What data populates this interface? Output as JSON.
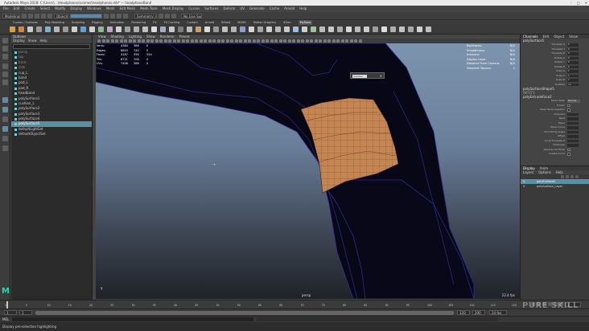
{
  "window": {
    "title": "Autodesk Maya 2018: C:\\Users\\...\\Headphones\\scenes\\headphones.mb* — headphoneBand",
    "controls": [
      "minimize-icon",
      "maximize-icon",
      "close-icon"
    ]
  },
  "menubar": {
    "items": [
      "File",
      "Edit",
      "Create",
      "Select",
      "Modify",
      "Display",
      "Windows",
      "Mesh",
      "Edit Mesh",
      "Mesh Tools",
      "Mesh Display",
      "Curves",
      "Surfaces",
      "Deform",
      "UV",
      "Generate",
      "Cache",
      "Arnold",
      "Help"
    ]
  },
  "statusline": {
    "mode_menu": "Modeling",
    "object_selector": "Objects",
    "symmetry": "Symmetry: Off",
    "no_live": "No Live Surface"
  },
  "shelf": {
    "tabs": [
      "Curves / Surfaces",
      "Poly Modeling",
      "Sculpting",
      "Rigging",
      "Animation",
      "Rendering",
      "FX",
      "FX Caching",
      "Custom",
      "Arnold",
      "Bifrost",
      "MASH",
      "Motion Graphics",
      "XGen",
      "MyTools"
    ],
    "active_tab": "MyTools",
    "icon_colors": [
      "#d5a24a",
      "#e0803a",
      "#c9c9c9",
      "#9a9a9a",
      "#7fb0d0",
      "#b7b7b7",
      "#9a9a9a",
      "#cfcfcf",
      "#6b9fd1",
      "#d1d1d1",
      "#8fb98f",
      "#c8a0d0",
      "#d0d0d0",
      "#a0a0a0",
      "#b0b0b0",
      "#c0c0c0",
      "#dddddd",
      "#9fb0c8",
      "#c8c8c8",
      "#7c7c7c",
      "#bbbbbb",
      "#d0a060",
      "#dddddd",
      "#9a9a9a",
      "#c0c0c0",
      "#b5b5b5",
      "#8aa0c8",
      "#d5d5d5",
      "#a5a5a5",
      "#cfcfcf",
      "#b8b8b8",
      "#c8c8c8",
      "#9fbfdf",
      "#d0d0d0",
      "#a0c0a0",
      "#bbbbbb",
      "#c9c9c9",
      "#aaaaaa",
      "#d9d9d9",
      "#bcbcbc",
      "#cccccc",
      "#9d9d9d",
      "#dddddd",
      "#b0b0b0",
      "#c4c4c4",
      "#a8a8a8",
      "#d2d2d2",
      "#bfbfbf"
    ]
  },
  "outliner": {
    "title": "Outliner",
    "menus": [
      "Display",
      "Show",
      "Help"
    ],
    "items": [
      {
        "label": "persp",
        "state": "dim"
      },
      {
        "label": "top",
        "state": "dim"
      },
      {
        "label": "front",
        "state": "dim"
      },
      {
        "label": "side",
        "state": "dim"
      },
      {
        "label": "cup_L",
        "state": "normal"
      },
      {
        "label": "band",
        "state": "normal"
      },
      {
        "label": "pad_L",
        "state": "normal"
      },
      {
        "label": "pad_R",
        "state": "normal"
      },
      {
        "label": "headband",
        "state": "normal"
      },
      {
        "label": "polySurface1",
        "state": "normal"
      },
      {
        "label": "cushion_L",
        "state": "normal"
      },
      {
        "label": "polySurface2",
        "state": "normal"
      },
      {
        "label": "polySurface3",
        "state": "normal"
      },
      {
        "label": "polySurface4",
        "state": "normal"
      },
      {
        "label": "polySurface5",
        "state": "selected"
      },
      {
        "label": "defaultLightSet",
        "state": "normal"
      },
      {
        "label": "defaultObjectSet",
        "state": "normal"
      }
    ]
  },
  "viewport": {
    "menus": [
      "View",
      "Shading",
      "Lighting",
      "Show",
      "Renderer",
      "Panels"
    ],
    "hud_left": {
      "header": [
        "",
        "",
        "",
        ""
      ],
      "rows": [
        {
          "label": "Verts:",
          "values": [
            "4384",
            "386",
            "0"
          ]
        },
        {
          "label": "Edges:",
          "values": [
            "8843",
            "740",
            "0"
          ]
        },
        {
          "label": "Faces:",
          "values": [
            "4187",
            "356",
            "354"
          ]
        },
        {
          "label": "Tris:",
          "values": [
            "8721",
            "708",
            "0"
          ]
        },
        {
          "label": "UVs:",
          "values": [
            "7408",
            "386",
            "0"
          ]
        }
      ]
    },
    "hud_right": [
      {
        "label": "Backfaces:",
        "value": "N/A"
      },
      {
        "label": "Smoothness:",
        "value": "N/A"
      },
      {
        "label": "Instance:",
        "value": "N/A"
      },
      {
        "label": "Display Layer:",
        "value": "N/A"
      },
      {
        "label": "Distance From Camera:",
        "value": "N/A"
      },
      {
        "label": "Selected Objects:",
        "value": "1"
      }
    ],
    "popup_input": "Subdivs",
    "camera_name": "persp",
    "fps": "22.4 fps",
    "axis_label": "Y"
  },
  "attribute_editor": {
    "tabs": [
      "Channels",
      "Edit",
      "Object",
      "Show"
    ],
    "node_name": "polySurface5",
    "shape_name": "polySurfaceShape5",
    "inputs_label": "INPUTS",
    "input_node": "polyExtrudeFace2",
    "transform_attrs": [
      {
        "label": "Translate X",
        "value": "0"
      },
      {
        "label": "Translate Y",
        "value": "0"
      },
      {
        "label": "Translate Z",
        "value": "0"
      },
      {
        "label": "Rotate X",
        "value": "0"
      },
      {
        "label": "Rotate Y",
        "value": "0"
      },
      {
        "label": "Rotate Z",
        "value": "0"
      },
      {
        "label": "Scale X",
        "value": "1"
      },
      {
        "label": "Scale Y",
        "value": "1"
      },
      {
        "label": "Scale Z",
        "value": "1"
      },
      {
        "label": "Visibility",
        "value": "on"
      }
    ],
    "extrude_attrs": [
      {
        "label": "Node State",
        "kind": "dd",
        "value": "Normal"
      },
      {
        "label": "Frozen",
        "kind": "chk"
      },
      {
        "label": "Keep Faces Together",
        "kind": "chk"
      },
      {
        "label": "Divisions",
        "kind": "fld"
      },
      {
        "label": "Twist",
        "kind": "fld"
      },
      {
        "label": "Taper",
        "kind": "fld"
      },
      {
        "label": "Taper Curve",
        "kind": "fld"
      },
      {
        "label": "Smoothing Angle",
        "kind": "fld"
      },
      {
        "label": "Offset",
        "kind": "fld"
      },
      {
        "label": "Local Translate Z",
        "kind": "fld"
      },
      {
        "label": "Thickness",
        "kind": "fld"
      },
      {
        "label": "Reverse All Faces",
        "kind": "chk"
      },
      {
        "label": "Create Curve",
        "kind": "chk"
      }
    ]
  },
  "layers": {
    "tabs": [
      "Display",
      "Anim"
    ],
    "menus": [
      "Layers",
      "Options",
      "Help"
    ],
    "items": [
      {
        "label": "polySurface5",
        "selected": true
      },
      {
        "label": "polySurface_Layer",
        "selected": false
      }
    ]
  },
  "timeslider": {
    "ticks": [
      "1",
      "5",
      "10",
      "15",
      "20",
      "25",
      "30",
      "35",
      "40",
      "45",
      "50",
      "55",
      "60",
      "65",
      "70",
      "75",
      "80",
      "85",
      "90",
      "95",
      "100",
      "105",
      "110",
      "115",
      "120"
    ],
    "current": "1"
  },
  "rangeslider": {
    "start": "1",
    "range_start": "1",
    "range_end": "120",
    "end": "200",
    "fps": "24 fps"
  },
  "cmdline": {
    "lang": "MEL"
  },
  "helpline": {
    "text": "Display pre-selection highlighting"
  },
  "watermark": "PURE SKILL"
}
